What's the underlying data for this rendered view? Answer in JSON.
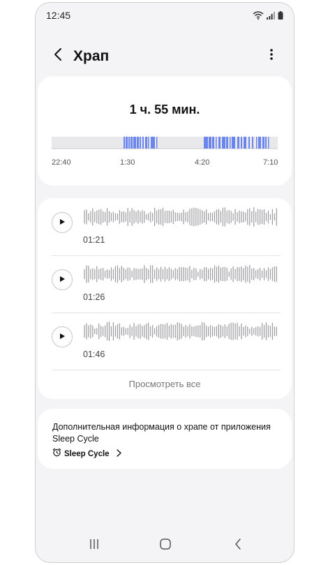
{
  "status_bar": {
    "time": "12:45"
  },
  "header": {
    "title": "Храп"
  },
  "summary": {
    "duration": "1 ч. 55 мин.",
    "time_labels": [
      "22:40",
      "1:30",
      "4:20",
      "7:10"
    ]
  },
  "recordings": [
    {
      "duration": "01:21"
    },
    {
      "duration": "01:26"
    },
    {
      "duration": "01:46"
    }
  ],
  "view_all_label": "Просмотреть все",
  "info": {
    "text": "Дополнительная информация о храпе от приложения Sleep Cycle",
    "app_link_label": "Sleep Cycle"
  },
  "colors": {
    "accent": "#6b85ee",
    "timeline_bg": "#e9e9ec",
    "wave": "#9a9a9e"
  },
  "icons": [
    "wifi-icon",
    "signal-icon",
    "battery-icon",
    "back-arrow-icon",
    "more-icon",
    "play-icon",
    "alarm-icon",
    "chevron-right-icon",
    "recents-icon",
    "home-icon",
    "nav-back-icon"
  ]
}
